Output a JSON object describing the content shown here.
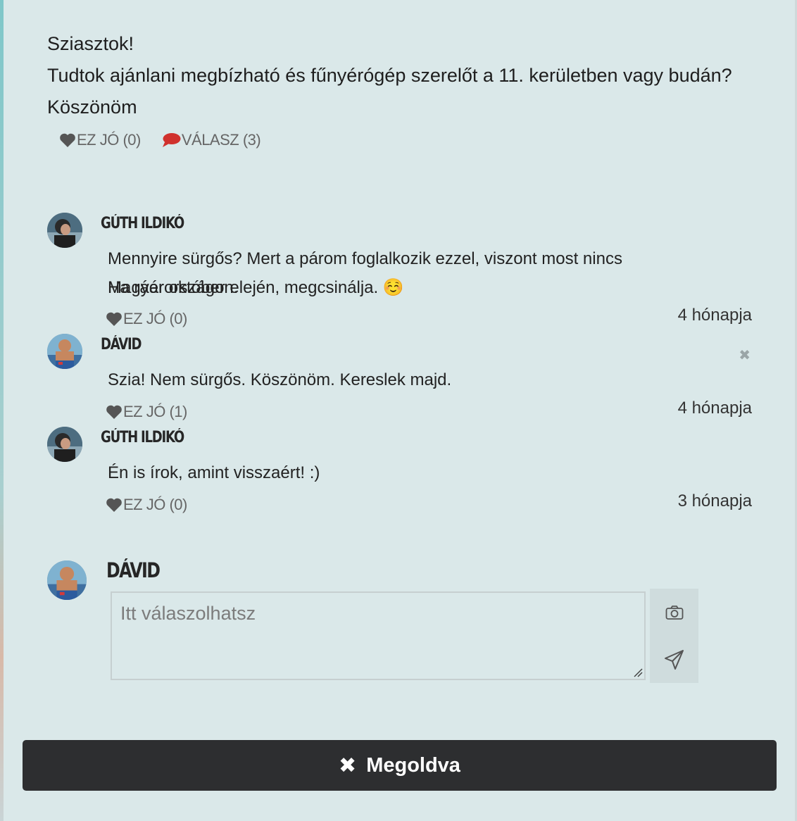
{
  "post": {
    "lines": [
      "Sziasztok!",
      "Tudtok ajánlani megbízható és fűnyérógép szerelőt a 11. kerületben vagy budán?",
      "Köszönöm"
    ],
    "like_label": "EZ JÓ (0)",
    "reply_label": "VÁLASZ (3)"
  },
  "comments": [
    {
      "author": "GÚTH ILDIKÓ",
      "line1": "Mennyire sürgős? Mert a párom foglalkozik ezzel, viszont most nincs Magyarországon.",
      "line2": "Ha ráér október elején, megcsinálja. ☺️",
      "like_label": "EZ JÓ (0)",
      "time": "4 hónapja"
    },
    {
      "author": "DÁVID",
      "line1": "Szia! Nem sürgős. Köszönöm. Kereslek majd.",
      "line2": "",
      "like_label": "EZ JÓ (1)",
      "time": "4 hónapja",
      "close_symbol": "✖"
    },
    {
      "author": "GÚTH ILDIKÓ",
      "line1": "Én is írok, amint visszaért! :)",
      "line2": "",
      "like_label": "EZ JÓ (0)",
      "time": "3 hónapja"
    }
  ],
  "reply": {
    "author": "DÁVID",
    "placeholder": "Itt válaszolhatsz",
    "camera_icon": "camera-icon",
    "send_icon": "send-icon"
  },
  "solve_button": {
    "icon": "✖",
    "label": "Megoldva"
  },
  "colors": {
    "background": "#dae8e9",
    "like_icon": "#555555",
    "reply_icon": "#d0312d",
    "button_bg": "#2d2e30"
  }
}
